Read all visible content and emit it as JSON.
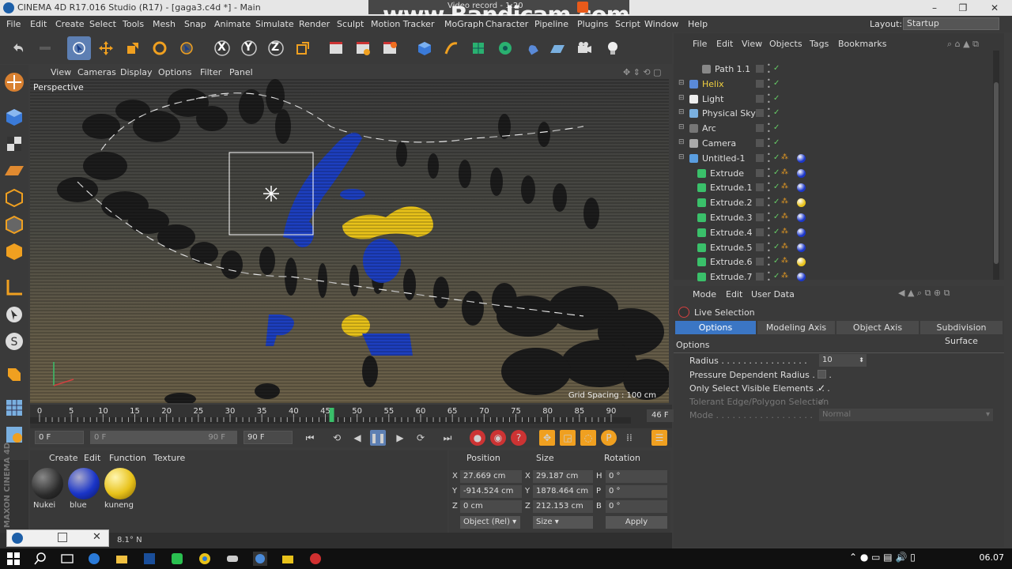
{
  "titlebar": {
    "title": "CINEMA 4D R17.016 Studio (R17) - [gaga3.c4d *] - Main",
    "min": "–",
    "max": "❐",
    "close": "✕"
  },
  "bandicam": {
    "recording_label": "Video record - 1:20",
    "watermark": "www.Bandicam.com"
  },
  "menubar": {
    "items": [
      "File",
      "Edit",
      "Create",
      "Select",
      "Tools",
      "Mesh",
      "Snap",
      "Animate",
      "Simulate",
      "Render",
      "Sculpt",
      "Motion Tracker",
      "MoGraph",
      "Character",
      "Pipeline",
      "Plugins",
      "Script",
      "Window",
      "Help"
    ],
    "layout_label": "Layout:",
    "layout_value": "Startup"
  },
  "toolbar": {
    "icons": [
      "undo-icon",
      "redo-icon",
      "live-selection-icon",
      "move-icon",
      "scale-icon",
      "rotate-icon",
      "select-icon",
      "x-axis-icon",
      "y-axis-icon",
      "z-axis-icon",
      "world-coord-icon",
      "render-view-icon",
      "render-picture-queue-icon",
      "edit-render-settings-icon",
      "cube-icon",
      "pen-spline-icon",
      "subdivision-icon",
      "cloner-icon",
      "deformer-icon",
      "floor-icon",
      "camera-icon",
      "light-icon"
    ],
    "x_label": "X",
    "y_label": "Y",
    "z_label": "Z"
  },
  "viewport": {
    "menu": [
      "View",
      "Cameras",
      "Display",
      "Options",
      "Filter",
      "Panel"
    ],
    "label": "Perspective",
    "grid_spacing": "Grid Spacing : 100 cm"
  },
  "timeline": {
    "ticks": [
      "0",
      "5",
      "10",
      "15",
      "20",
      "25",
      "30",
      "35",
      "40",
      "45",
      "50",
      "55",
      "60",
      "65",
      "70",
      "75",
      "80",
      "85",
      "90"
    ],
    "current_frame": 46,
    "max_frame": 90,
    "frame_field": "46 F"
  },
  "playback": {
    "start_field": "0 F",
    "range_start": "0 F",
    "range_end": "90 F",
    "end_field": "90 F"
  },
  "materials": {
    "menu": [
      "Create",
      "Edit",
      "Function",
      "Texture"
    ],
    "items": [
      {
        "name": "Nukei",
        "color": "#2a2a2a"
      },
      {
        "name": "blue",
        "color": "#1a35c8"
      },
      {
        "name": "kuneng",
        "color": "#e8c21a"
      }
    ]
  },
  "coordinates": {
    "headers": {
      "position": "Position",
      "size": "Size",
      "rotation": "Rotation"
    },
    "rows": [
      {
        "axis": "X",
        "pos": "27.669 cm",
        "size_axis": "X",
        "size": "29.187 cm",
        "rot_axis": "H",
        "rot": "0 °"
      },
      {
        "axis": "Y",
        "pos": "-914.524 cm",
        "size_axis": "Y",
        "size": "1878.464 cm",
        "rot_axis": "P",
        "rot": "0 °"
      },
      {
        "axis": "Z",
        "pos": "0 cm",
        "size_axis": "Z",
        "size": "212.153 cm",
        "rot_axis": "B",
        "rot": "0 °"
      }
    ],
    "mode_select": "Object (Rel)",
    "size_select": "Size",
    "apply_label": "Apply"
  },
  "statusbar": {
    "text": "8.1° N"
  },
  "object_manager": {
    "menu": [
      "File",
      "Edit",
      "View",
      "Objects",
      "Tags",
      "Bookmarks"
    ],
    "rows": [
      {
        "name": "Path 1.1",
        "indent": 36,
        "icon_color": "#888",
        "name_color": "#ddd",
        "material": ""
      },
      {
        "name": "Helix",
        "indent": 20,
        "icon_color": "#5a8ad8",
        "name_color": "#f0d040",
        "material": ""
      },
      {
        "name": "Light",
        "indent": 20,
        "icon_color": "#eeeeee",
        "name_color": "#ddd",
        "material": ""
      },
      {
        "name": "Physical Sky",
        "indent": 20,
        "icon_color": "#7ab0e0",
        "name_color": "#ddd",
        "material": ""
      },
      {
        "name": "Arc",
        "indent": 20,
        "icon_color": "#777",
        "name_color": "#ddd",
        "material": ""
      },
      {
        "name": "Camera",
        "indent": 20,
        "icon_color": "#aaa",
        "name_color": "#ddd",
        "material": ""
      },
      {
        "name": "Untitled-1",
        "indent": 20,
        "icon_color": "#5a9ee0",
        "name_color": "#ddd",
        "material": "#1a35c8"
      },
      {
        "name": "Extrude",
        "indent": 30,
        "icon_color": "#3ac06a",
        "name_color": "#ddd",
        "material": "#1a35c8"
      },
      {
        "name": "Extrude.1",
        "indent": 30,
        "icon_color": "#3ac06a",
        "name_color": "#ddd",
        "material": "#1a35c8"
      },
      {
        "name": "Extrude.2",
        "indent": 30,
        "icon_color": "#3ac06a",
        "name_color": "#ddd",
        "material": "#e8c21a"
      },
      {
        "name": "Extrude.3",
        "indent": 30,
        "icon_color": "#3ac06a",
        "name_color": "#ddd",
        "material": "#1a35c8"
      },
      {
        "name": "Extrude.4",
        "indent": 30,
        "icon_color": "#3ac06a",
        "name_color": "#ddd",
        "material": "#1a35c8"
      },
      {
        "name": "Extrude.5",
        "indent": 30,
        "icon_color": "#3ac06a",
        "name_color": "#ddd",
        "material": "#1a35c8"
      },
      {
        "name": "Extrude.6",
        "indent": 30,
        "icon_color": "#3ac06a",
        "name_color": "#ddd",
        "material": "#e8c21a"
      },
      {
        "name": "Extrude.7",
        "indent": 30,
        "icon_color": "#3ac06a",
        "name_color": "#ddd",
        "material": "#1a35c8"
      }
    ]
  },
  "attribute_manager": {
    "menu": [
      "Mode",
      "Edit",
      "User Data"
    ],
    "tool_name": "Live Selection",
    "tabs": [
      "Options",
      "Modeling Axis",
      "Object Axis",
      "Subdivision Surface"
    ],
    "section": "Options",
    "radius_label": "Radius . . . . . . . . . . . . . . . .",
    "radius_value": "10",
    "pressure_label": "Pressure Dependent Radius . . . .",
    "visible_label": "Only Select Visible Elements . . .",
    "tolerant_label": "Tolerant Edge/Polygon Selection",
    "mode_label": "Mode . . . . . . . . . . . . . . . . . .",
    "mode_value": "Normal"
  },
  "taskbar": {
    "time": "06.07"
  }
}
